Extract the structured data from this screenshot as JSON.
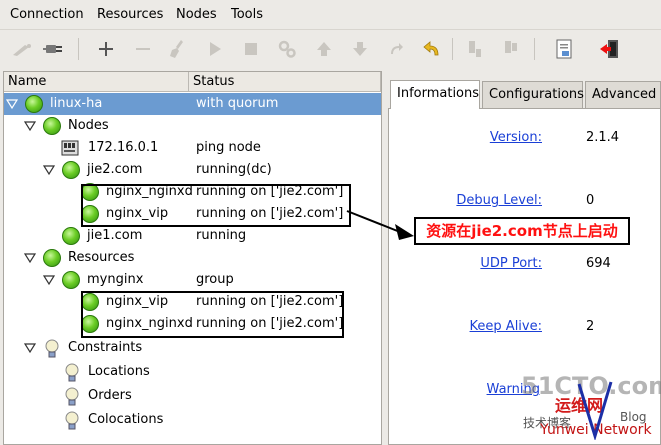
{
  "menu": [
    "Connection",
    "Resources",
    "Nodes",
    "Tools"
  ],
  "columns": {
    "name": "Name",
    "status": "Status"
  },
  "tree": [
    {
      "label": "linux-ha",
      "status": "with quorum"
    },
    {
      "label": "Nodes",
      "status": ""
    },
    {
      "label": "172.16.0.1",
      "status": "ping node"
    },
    {
      "label": "jie2.com",
      "status": "running(dc)"
    },
    {
      "label": "nginx_nginxd",
      "status": "running on ['jie2.com']"
    },
    {
      "label": "nginx_vip",
      "status": "running on ['jie2.com']"
    },
    {
      "label": "jie1.com",
      "status": "running"
    },
    {
      "label": "Resources",
      "status": ""
    },
    {
      "label": "mynginx",
      "status": "group"
    },
    {
      "label": "nginx_vip",
      "status": "running on ['jie2.com']"
    },
    {
      "label": "nginx_nginxd",
      "status": "running on ['jie2.com']"
    },
    {
      "label": "Constraints",
      "status": ""
    },
    {
      "label": "Locations",
      "status": ""
    },
    {
      "label": "Orders",
      "status": ""
    },
    {
      "label": "Colocations",
      "status": ""
    }
  ],
  "tabs": [
    "Informations",
    "Configurations",
    "Advanced"
  ],
  "info": [
    {
      "label": "Version:",
      "value": "2.1.4"
    },
    {
      "label": "Debug Level:",
      "value": "0"
    },
    {
      "label": "UDP Port:",
      "value": "694"
    },
    {
      "label": "Keep Alive:",
      "value": "2"
    },
    {
      "label": "Warning ",
      "value": ""
    }
  ],
  "annotation": "资源在jie2.com节点上启动",
  "watermark": {
    "site": "51CTO.com",
    "cn1": "运维网",
    "cn2": "技术博客",
    "blog": "Blog",
    "net": "Yunwei Network"
  },
  "colors": {
    "selection": "#6b9bd1",
    "link": "#1a3fd6",
    "annotation": "#ff1010",
    "status_ok": "#6ccd26"
  }
}
